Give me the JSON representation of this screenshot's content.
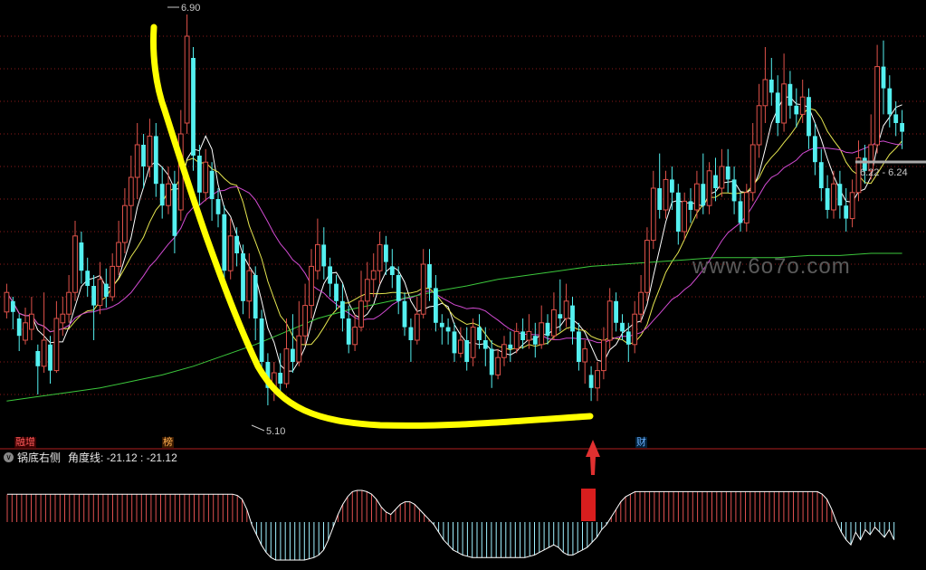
{
  "colors": {
    "background": "#000000",
    "up_candle": "#e0524a",
    "down_candle": "#54f0f0",
    "ma5": "#ffffff",
    "ma10": "#e6e650",
    "ma20": "#d24bd2",
    "ma60": "#3cc83c",
    "grid": "#8b1a1a",
    "separator": "#b02020",
    "annotation_curve": "#ffff00",
    "signal_bar": "#d81e1e",
    "signal_arrow": "#e03030",
    "indicator_positive": "#e05050",
    "indicator_negative": "#a0f0ff"
  },
  "price_labels": {
    "high": "6.90",
    "low": "5.10",
    "range": "6.22 - 6.24"
  },
  "watermark": "www.6o7o.com",
  "badges": [
    "融增",
    "榜",
    "财"
  ],
  "indicator": {
    "name": "锅底右侧",
    "line_label": "角度线: -21.12 : -21.12",
    "collapse_icon": "chevron-down-icon"
  },
  "chart_data": [
    {
      "type": "candlestick",
      "title": "",
      "ylim": [
        5.0,
        6.95
      ],
      "high": 6.9,
      "low": 5.1,
      "candles": [
        [
          5.53,
          5.62,
          5.5,
          5.66
        ],
        [
          5.58,
          5.53,
          5.45,
          5.6
        ],
        [
          5.5,
          5.42,
          5.35,
          5.52
        ],
        [
          5.4,
          5.48,
          5.38,
          5.55
        ],
        [
          5.45,
          5.52,
          5.4,
          5.6
        ],
        [
          5.35,
          5.28,
          5.15,
          5.38
        ],
        [
          5.28,
          5.4,
          5.25,
          5.62
        ],
        [
          5.38,
          5.26,
          5.2,
          5.42
        ],
        [
          5.26,
          5.5,
          5.25,
          5.58
        ],
        [
          5.48,
          5.52,
          5.42,
          5.6
        ],
        [
          5.52,
          5.62,
          5.48,
          5.7
        ],
        [
          5.62,
          5.88,
          5.58,
          5.95
        ],
        [
          5.85,
          5.72,
          5.66,
          5.9
        ],
        [
          5.72,
          5.65,
          5.6,
          5.78
        ],
        [
          5.65,
          5.56,
          5.4,
          5.7
        ],
        [
          5.56,
          5.68,
          5.52,
          5.76
        ],
        [
          5.66,
          5.6,
          5.55,
          5.73
        ],
        [
          5.6,
          5.74,
          5.58,
          5.8
        ],
        [
          5.74,
          5.85,
          5.7,
          5.95
        ],
        [
          5.85,
          6.02,
          5.8,
          6.1
        ],
        [
          6.02,
          6.15,
          5.95,
          6.25
        ],
        [
          6.15,
          6.3,
          6.05,
          6.4
        ],
        [
          6.3,
          6.2,
          6.1,
          6.35
        ],
        [
          6.2,
          6.34,
          6.15,
          6.42
        ],
        [
          6.34,
          6.12,
          6.06,
          6.4
        ],
        [
          6.12,
          6.02,
          5.96,
          6.2
        ],
        [
          6.02,
          6.12,
          5.98,
          6.2
        ],
        [
          6.12,
          5.88,
          5.8,
          6.18
        ],
        [
          6.0,
          6.35,
          5.95,
          6.46
        ],
        [
          6.4,
          6.8,
          6.35,
          6.9
        ],
        [
          6.7,
          6.25,
          6.18,
          6.75
        ],
        [
          6.25,
          6.08,
          6.02,
          6.3
        ],
        [
          6.08,
          6.22,
          6.04,
          6.28
        ],
        [
          6.18,
          6.05,
          5.95,
          6.22
        ],
        [
          6.05,
          5.98,
          5.92,
          6.1
        ],
        [
          5.98,
          5.72,
          5.66,
          6.02
        ],
        [
          5.72,
          5.88,
          5.68,
          5.96
        ],
        [
          5.88,
          5.8,
          5.74,
          5.92
        ],
        [
          5.8,
          5.58,
          5.52,
          5.84
        ],
        [
          5.58,
          5.72,
          5.5,
          5.8
        ],
        [
          5.7,
          5.5,
          5.4,
          5.74
        ],
        [
          5.5,
          5.3,
          5.24,
          5.54
        ],
        [
          5.3,
          5.18,
          5.1,
          5.34
        ],
        [
          5.18,
          5.25,
          5.12,
          5.3
        ],
        [
          5.25,
          5.2,
          5.14,
          5.34
        ],
        [
          5.2,
          5.36,
          5.18,
          5.5
        ],
        [
          5.36,
          5.3,
          5.25,
          5.52
        ],
        [
          5.3,
          5.42,
          5.28,
          5.58
        ],
        [
          5.42,
          5.56,
          5.38,
          5.66
        ],
        [
          5.56,
          5.74,
          5.5,
          5.82
        ],
        [
          5.72,
          5.84,
          5.68,
          5.96
        ],
        [
          5.84,
          5.74,
          5.68,
          5.92
        ],
        [
          5.74,
          5.66,
          5.6,
          5.78
        ],
        [
          5.66,
          5.58,
          5.54,
          5.7
        ],
        [
          5.58,
          5.5,
          5.44,
          5.66
        ],
        [
          5.5,
          5.38,
          5.34,
          5.56
        ],
        [
          5.38,
          5.46,
          5.35,
          5.52
        ],
        [
          5.46,
          5.58,
          5.44,
          5.72
        ],
        [
          5.58,
          5.68,
          5.54,
          5.76
        ],
        [
          5.68,
          5.72,
          5.6,
          5.8
        ],
        [
          5.72,
          5.84,
          5.66,
          5.9
        ],
        [
          5.84,
          5.76,
          5.7,
          5.88
        ],
        [
          5.74,
          5.7,
          5.64,
          5.82
        ],
        [
          5.7,
          5.58,
          5.52,
          5.74
        ],
        [
          5.58,
          5.46,
          5.42,
          5.62
        ],
        [
          5.46,
          5.4,
          5.3,
          5.5
        ],
        [
          5.4,
          5.52,
          5.38,
          5.6
        ],
        [
          5.52,
          5.75,
          5.5,
          5.82
        ],
        [
          5.75,
          5.64,
          5.58,
          5.82
        ],
        [
          5.64,
          5.48,
          5.44,
          5.7
        ],
        [
          5.48,
          5.46,
          5.38,
          5.52
        ],
        [
          5.46,
          5.44,
          5.38,
          5.5
        ],
        [
          5.44,
          5.34,
          5.3,
          5.48
        ],
        [
          5.34,
          5.4,
          5.32,
          5.46
        ],
        [
          5.4,
          5.3,
          5.26,
          5.46
        ],
        [
          5.32,
          5.46,
          5.28,
          5.5
        ],
        [
          5.46,
          5.4,
          5.36,
          5.52
        ],
        [
          5.4,
          5.36,
          5.28,
          5.46
        ],
        [
          5.36,
          5.24,
          5.18,
          5.4
        ],
        [
          5.24,
          5.32,
          5.22,
          5.36
        ],
        [
          5.32,
          5.38,
          5.28,
          5.42
        ],
        [
          5.38,
          5.36,
          5.3,
          5.44
        ],
        [
          5.36,
          5.44,
          5.34,
          5.48
        ],
        [
          5.44,
          5.4,
          5.36,
          5.5
        ],
        [
          5.4,
          5.44,
          5.36,
          5.52
        ],
        [
          5.42,
          5.38,
          5.32,
          5.48
        ],
        [
          5.38,
          5.48,
          5.36,
          5.56
        ],
        [
          5.48,
          5.42,
          5.38,
          5.52
        ],
        [
          5.42,
          5.54,
          5.4,
          5.62
        ],
        [
          5.52,
          5.5,
          5.44,
          5.68
        ],
        [
          5.5,
          5.58,
          5.46,
          5.66
        ],
        [
          5.56,
          5.44,
          5.38,
          5.6
        ],
        [
          5.44,
          5.3,
          5.26,
          5.48
        ],
        [
          5.3,
          5.36,
          5.2,
          5.4
        ],
        [
          5.24,
          5.18,
          5.12,
          5.28
        ],
        [
          5.18,
          5.26,
          5.12,
          5.3
        ],
        [
          5.26,
          5.4,
          5.22,
          5.46
        ],
        [
          5.4,
          5.58,
          5.36,
          5.64
        ],
        [
          5.58,
          5.48,
          5.44,
          5.62
        ],
        [
          5.48,
          5.44,
          5.4,
          5.52
        ],
        [
          5.44,
          5.38,
          5.3,
          5.48
        ],
        [
          5.38,
          5.52,
          5.34,
          5.58
        ],
        [
          5.52,
          5.62,
          5.48,
          5.7
        ],
        [
          5.62,
          5.86,
          5.58,
          5.92
        ],
        [
          5.86,
          6.1,
          5.82,
          6.18
        ],
        [
          6.1,
          6.0,
          5.96,
          6.26
        ],
        [
          6.0,
          6.14,
          5.96,
          6.18
        ],
        [
          6.14,
          6.08,
          6.0,
          6.2
        ],
        [
          6.08,
          5.9,
          5.84,
          6.12
        ],
        [
          5.9,
          6.04,
          5.86,
          6.08
        ],
        [
          6.04,
          6.0,
          5.94,
          6.1
        ],
        [
          6.0,
          6.12,
          5.96,
          6.18
        ],
        [
          6.12,
          6.02,
          5.98,
          6.26
        ],
        [
          6.02,
          6.18,
          5.98,
          6.22
        ],
        [
          6.16,
          6.1,
          6.04,
          6.24
        ],
        [
          6.1,
          6.2,
          6.06,
          6.28
        ],
        [
          6.2,
          6.14,
          6.08,
          6.28
        ],
        [
          6.14,
          6.04,
          5.98,
          6.2
        ],
        [
          6.04,
          5.94,
          5.9,
          6.08
        ],
        [
          5.94,
          6.08,
          5.9,
          6.12
        ],
        [
          6.08,
          6.3,
          6.04,
          6.4
        ],
        [
          6.3,
          6.48,
          6.24,
          6.58
        ],
        [
          6.48,
          6.6,
          6.4,
          6.75
        ],
        [
          6.6,
          6.54,
          6.48,
          6.7
        ],
        [
          6.54,
          6.4,
          6.34,
          6.62
        ],
        [
          6.4,
          6.58,
          6.36,
          6.72
        ],
        [
          6.58,
          6.48,
          6.42,
          6.64
        ],
        [
          6.48,
          6.44,
          6.38,
          6.56
        ],
        [
          6.44,
          6.52,
          6.4,
          6.6
        ],
        [
          6.52,
          6.34,
          6.28,
          6.56
        ],
        [
          6.34,
          6.22,
          6.16,
          6.4
        ],
        [
          6.22,
          6.1,
          6.04,
          6.28
        ],
        [
          6.1,
          6.0,
          5.96,
          6.16
        ],
        [
          6.0,
          6.12,
          5.96,
          6.18
        ],
        [
          6.12,
          6.02,
          5.96,
          6.18
        ],
        [
          6.02,
          5.96,
          5.9,
          6.1
        ],
        [
          5.96,
          6.08,
          5.92,
          6.14
        ],
        [
          6.08,
          6.24,
          6.04,
          6.32
        ],
        [
          6.24,
          6.18,
          6.12,
          6.3
        ],
        [
          6.18,
          6.3,
          6.14,
          6.44
        ],
        [
          6.3,
          6.66,
          6.26,
          6.76
        ],
        [
          6.66,
          6.56,
          6.44,
          6.78
        ],
        [
          6.56,
          6.44,
          6.38,
          6.62
        ],
        [
          6.44,
          6.4,
          6.34,
          6.5
        ],
        [
          6.4,
          6.36,
          6.28,
          6.46
        ]
      ],
      "ma60": [
        5.12,
        5.14,
        5.16,
        5.18,
        5.21,
        5.24,
        5.28,
        5.33,
        5.38,
        5.44,
        5.5,
        5.54,
        5.57,
        5.6,
        5.63,
        5.65,
        5.68,
        5.7,
        5.72,
        5.74,
        5.75,
        5.76,
        5.77,
        5.78,
        5.78,
        5.78,
        5.79,
        5.79,
        5.8,
        5.8
      ]
    },
    {
      "type": "bar",
      "title": "锅底右侧",
      "series_name": "角度线",
      "last_values": [
        -21.12,
        -21.12
      ],
      "values": [
        22,
        22,
        22,
        22,
        22,
        22,
        22,
        22,
        22,
        22,
        22,
        22,
        22,
        22,
        22,
        22,
        22,
        22,
        22,
        22,
        22,
        22,
        22,
        22,
        22,
        22,
        22,
        22,
        22,
        22,
        22,
        22,
        22,
        22,
        22,
        22,
        22,
        22,
        22,
        22,
        22,
        22,
        22,
        22,
        22,
        22,
        22,
        22,
        21,
        18,
        10,
        -2,
        -10,
        -18,
        -24,
        -28,
        -30,
        -30,
        -30,
        -30,
        -30,
        -30,
        -30,
        -29,
        -28,
        -26,
        -22,
        -14,
        -4,
        6,
        14,
        20,
        24,
        25,
        25,
        24,
        22,
        18,
        12,
        8,
        6,
        10,
        14,
        16,
        16,
        14,
        10,
        6,
        2,
        -2,
        -8,
        -14,
        -18,
        -22,
        -24,
        -26,
        -27,
        -28,
        -28,
        -28,
        -28,
        -28,
        -28,
        -28,
        -28,
        -28,
        -28,
        -28,
        -28,
        -27,
        -26,
        -24,
        -22,
        -20,
        -18,
        -20,
        -24,
        -26,
        -26,
        -24,
        -22,
        -20,
        -16,
        -12,
        -6,
        -2,
        4,
        10,
        16,
        20,
        22,
        24,
        24,
        24,
        24,
        24,
        24,
        24,
        24,
        24,
        24,
        24,
        24,
        24,
        24,
        24,
        24,
        24,
        24,
        24,
        24,
        24,
        24,
        24,
        24,
        24,
        24,
        24,
        24,
        24,
        24,
        24,
        24,
        24,
        24,
        24,
        24,
        24,
        24,
        24,
        22,
        18,
        10,
        0,
        -8,
        -14,
        -18,
        -8,
        -14,
        -6,
        -10,
        -4,
        -8,
        -12,
        -6,
        -14
      ],
      "signal_index": 129
    }
  ]
}
